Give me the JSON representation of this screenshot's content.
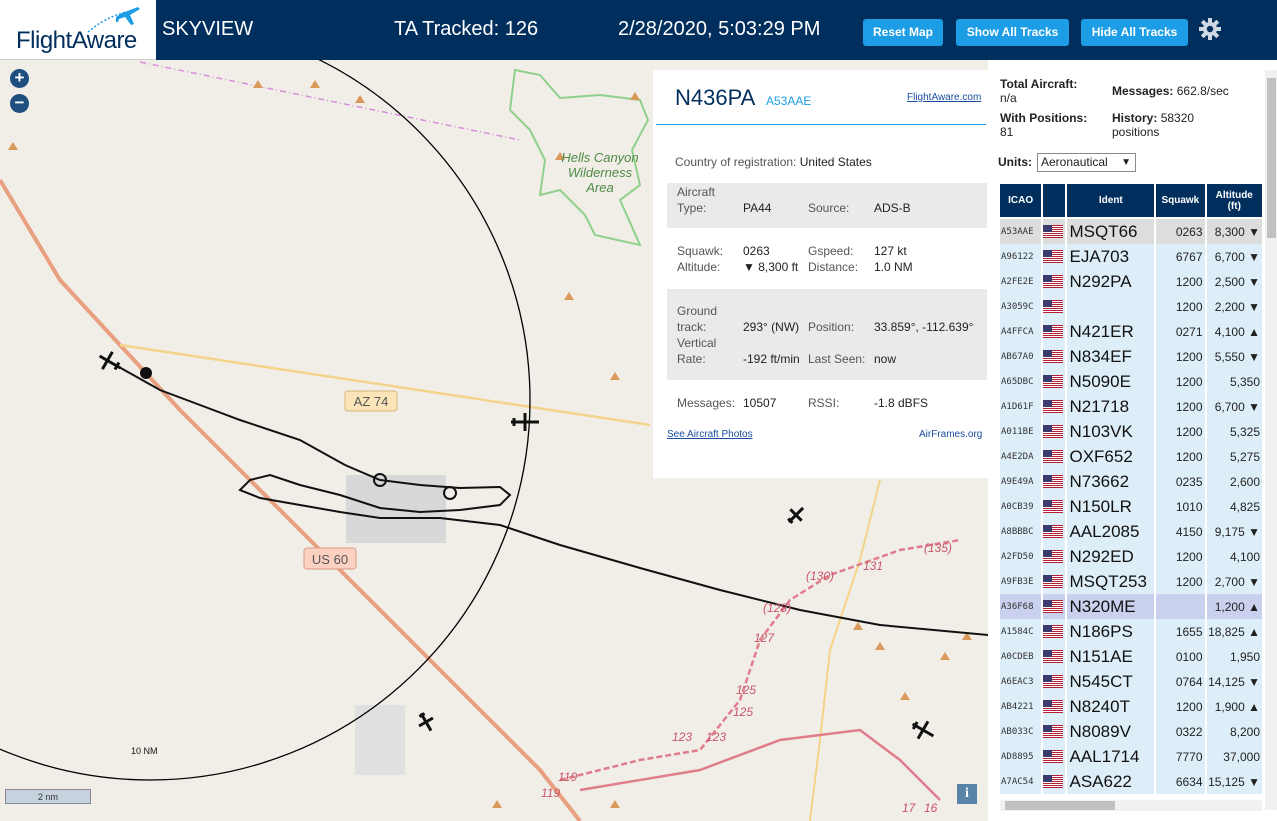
{
  "header": {
    "logo_text": "FlightAware",
    "app_name": "SKYVIEW",
    "tracked": "TA Tracked: 126",
    "datetime": "2/28/2020, 5:03:29 PM",
    "reset_map": "Reset Map",
    "show_all_tracks": "Show All Tracks",
    "hide_all_tracks": "Hide All Tracks",
    "settings_icon": "gear-icon"
  },
  "map": {
    "zoom_in": "+",
    "zoom_out": "−",
    "scale": "2 nm",
    "ring_label": "10 NM",
    "info": "i",
    "labels": {
      "wilderness_1": "Hells Canyon",
      "wilderness_2": "Wilderness",
      "wilderness_3": "Area",
      "az74": "AZ 74",
      "us60": "US 60",
      "r130": "(130)",
      "r131": "131",
      "r135": "(135)",
      "r128": "(128)",
      "r127": "127",
      "r125a": "125",
      "r125b": "125",
      "r123a": "123",
      "r123b": "123",
      "r119a": "119",
      "r119b": "119",
      "r17": "17",
      "r16": "16"
    }
  },
  "popup": {
    "registration": "N436PA",
    "hex": "A53AAE",
    "flightaware_link": "FlightAware.com",
    "country_label": "Country of registration:",
    "country": "United States",
    "aircraft_type_label_1": "Aircraft",
    "aircraft_type_label_2": "Type:",
    "aircraft_type": "PA44",
    "source_label": "Source:",
    "source": "ADS-B",
    "squawk_label": "Squawk:",
    "squawk": "0263",
    "gspeed_label": "Gspeed:",
    "gspeed": "127 kt",
    "altitude_label": "Altitude:",
    "altitude": "▼ 8,300 ft",
    "distance_label": "Distance:",
    "distance": "1.0 NM",
    "ground_label_1": "Ground",
    "ground_label_2": "track:",
    "ground_track": "293° (NW)",
    "position_label": "Position:",
    "position": "33.859°, -112.639°",
    "vertical_label_1": "Vertical",
    "vertical_label_2": "Rate:",
    "vertical_rate": "-192 ft/min",
    "last_seen_label": "Last Seen:",
    "last_seen": "now",
    "messages_label": "Messages:",
    "messages": "10507",
    "rssi_label": "RSSI:",
    "rssi": "-1.8 dBFS",
    "photos_link": "See Aircraft Photos",
    "airframes_link": "AirFrames.org"
  },
  "sidebar": {
    "total_aircraft_label": "Total Aircraft:",
    "total_aircraft": "n/a",
    "messages_label": "Messages:",
    "messages": "662.8/sec",
    "with_positions_label": "With Positions:",
    "with_positions": "81",
    "history_label": "History:",
    "history": "58320",
    "history_unit": "positions",
    "units_label": "Units:",
    "units_value": "Aeronautical",
    "columns": {
      "icao": "ICAO",
      "ident": "Ident",
      "squawk": "Squawk",
      "altitude_1": "Altitude",
      "altitude_2": "(ft)"
    },
    "rows": [
      {
        "icao": "A53AAE",
        "ident": "MSQT66",
        "squawk": "0263",
        "alt": "8,300 ▼"
      },
      {
        "icao": "A96122",
        "ident": "EJA703",
        "squawk": "6767",
        "alt": "6,700 ▼"
      },
      {
        "icao": "A2FE2E",
        "ident": "N292PA",
        "squawk": "1200",
        "alt": "2,500 ▼"
      },
      {
        "icao": "A3059C",
        "ident": "",
        "squawk": "1200",
        "alt": "2,200 ▼"
      },
      {
        "icao": "A4FFCA",
        "ident": "N421ER",
        "squawk": "0271",
        "alt": "4,100 ▲"
      },
      {
        "icao": "AB67A0",
        "ident": "N834EF",
        "squawk": "1200",
        "alt": "5,550 ▼"
      },
      {
        "icao": "A65DBC",
        "ident": "N5090E",
        "squawk": "1200",
        "alt": "5,350"
      },
      {
        "icao": "A1D61F",
        "ident": "N21718",
        "squawk": "1200",
        "alt": "6,700 ▼"
      },
      {
        "icao": "A011BE",
        "ident": "N103VK",
        "squawk": "1200",
        "alt": "5,325"
      },
      {
        "icao": "A4E2DA",
        "ident": "OXF652",
        "squawk": "1200",
        "alt": "5,275"
      },
      {
        "icao": "A9E49A",
        "ident": "N73662",
        "squawk": "0235",
        "alt": "2,600"
      },
      {
        "icao": "A0CB39",
        "ident": "N150LR",
        "squawk": "1010",
        "alt": "4,825"
      },
      {
        "icao": "A8BBBC",
        "ident": "AAL2085",
        "squawk": "4150",
        "alt": "9,175 ▼"
      },
      {
        "icao": "A2FD50",
        "ident": "N292ED",
        "squawk": "1200",
        "alt": "4,100"
      },
      {
        "icao": "A9FB3E",
        "ident": "MSQT253",
        "squawk": "1200",
        "alt": "2,700 ▼"
      },
      {
        "icao": "A36F68",
        "ident": "N320ME",
        "squawk": "",
        "alt": "1,200 ▲"
      },
      {
        "icao": "A1584C",
        "ident": "N186PS",
        "squawk": "1655",
        "alt": "18,825 ▲"
      },
      {
        "icao": "A0CDEB",
        "ident": "N151AE",
        "squawk": "0100",
        "alt": "1,950"
      },
      {
        "icao": "A6EAC3",
        "ident": "N545CT",
        "squawk": "0764",
        "alt": "14,125 ▼"
      },
      {
        "icao": "AB4221",
        "ident": "N8240T",
        "squawk": "1200",
        "alt": "1,900 ▲"
      },
      {
        "icao": "AB033C",
        "ident": "N8089V",
        "squawk": "0322",
        "alt": "8,200"
      },
      {
        "icao": "AD8895",
        "ident": "AAL1714",
        "squawk": "7770",
        "alt": "37,000"
      },
      {
        "icao": "A7AC54",
        "ident": "ASA622",
        "squawk": "6634",
        "alt": "15,125 ▼"
      }
    ]
  },
  "colors": {
    "header_bg": "#002f5d",
    "button": "#1c9de6",
    "map_bg": "#f1eee8",
    "table_row": "#ddeef8",
    "table_selected": "#dddddd",
    "table_highlight": "#cad1ee"
  }
}
